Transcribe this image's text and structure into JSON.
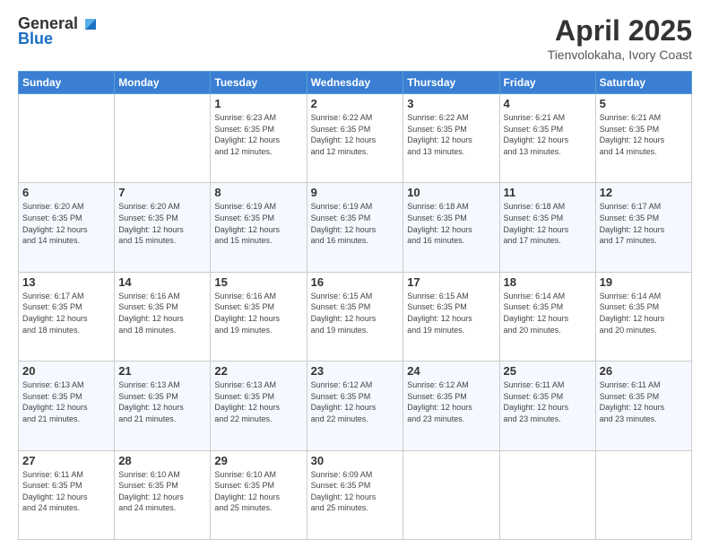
{
  "logo": {
    "line1": "General",
    "line2": "Blue"
  },
  "title": "April 2025",
  "location": "Tienvolokaha, Ivory Coast",
  "days_of_week": [
    "Sunday",
    "Monday",
    "Tuesday",
    "Wednesday",
    "Thursday",
    "Friday",
    "Saturday"
  ],
  "weeks": [
    [
      {
        "day": "",
        "info": ""
      },
      {
        "day": "",
        "info": ""
      },
      {
        "day": "1",
        "info": "Sunrise: 6:23 AM\nSunset: 6:35 PM\nDaylight: 12 hours\nand 12 minutes."
      },
      {
        "day": "2",
        "info": "Sunrise: 6:22 AM\nSunset: 6:35 PM\nDaylight: 12 hours\nand 12 minutes."
      },
      {
        "day": "3",
        "info": "Sunrise: 6:22 AM\nSunset: 6:35 PM\nDaylight: 12 hours\nand 13 minutes."
      },
      {
        "day": "4",
        "info": "Sunrise: 6:21 AM\nSunset: 6:35 PM\nDaylight: 12 hours\nand 13 minutes."
      },
      {
        "day": "5",
        "info": "Sunrise: 6:21 AM\nSunset: 6:35 PM\nDaylight: 12 hours\nand 14 minutes."
      }
    ],
    [
      {
        "day": "6",
        "info": "Sunrise: 6:20 AM\nSunset: 6:35 PM\nDaylight: 12 hours\nand 14 minutes."
      },
      {
        "day": "7",
        "info": "Sunrise: 6:20 AM\nSunset: 6:35 PM\nDaylight: 12 hours\nand 15 minutes."
      },
      {
        "day": "8",
        "info": "Sunrise: 6:19 AM\nSunset: 6:35 PM\nDaylight: 12 hours\nand 15 minutes."
      },
      {
        "day": "9",
        "info": "Sunrise: 6:19 AM\nSunset: 6:35 PM\nDaylight: 12 hours\nand 16 minutes."
      },
      {
        "day": "10",
        "info": "Sunrise: 6:18 AM\nSunset: 6:35 PM\nDaylight: 12 hours\nand 16 minutes."
      },
      {
        "day": "11",
        "info": "Sunrise: 6:18 AM\nSunset: 6:35 PM\nDaylight: 12 hours\nand 17 minutes."
      },
      {
        "day": "12",
        "info": "Sunrise: 6:17 AM\nSunset: 6:35 PM\nDaylight: 12 hours\nand 17 minutes."
      }
    ],
    [
      {
        "day": "13",
        "info": "Sunrise: 6:17 AM\nSunset: 6:35 PM\nDaylight: 12 hours\nand 18 minutes."
      },
      {
        "day": "14",
        "info": "Sunrise: 6:16 AM\nSunset: 6:35 PM\nDaylight: 12 hours\nand 18 minutes."
      },
      {
        "day": "15",
        "info": "Sunrise: 6:16 AM\nSunset: 6:35 PM\nDaylight: 12 hours\nand 19 minutes."
      },
      {
        "day": "16",
        "info": "Sunrise: 6:15 AM\nSunset: 6:35 PM\nDaylight: 12 hours\nand 19 minutes."
      },
      {
        "day": "17",
        "info": "Sunrise: 6:15 AM\nSunset: 6:35 PM\nDaylight: 12 hours\nand 19 minutes."
      },
      {
        "day": "18",
        "info": "Sunrise: 6:14 AM\nSunset: 6:35 PM\nDaylight: 12 hours\nand 20 minutes."
      },
      {
        "day": "19",
        "info": "Sunrise: 6:14 AM\nSunset: 6:35 PM\nDaylight: 12 hours\nand 20 minutes."
      }
    ],
    [
      {
        "day": "20",
        "info": "Sunrise: 6:13 AM\nSunset: 6:35 PM\nDaylight: 12 hours\nand 21 minutes."
      },
      {
        "day": "21",
        "info": "Sunrise: 6:13 AM\nSunset: 6:35 PM\nDaylight: 12 hours\nand 21 minutes."
      },
      {
        "day": "22",
        "info": "Sunrise: 6:13 AM\nSunset: 6:35 PM\nDaylight: 12 hours\nand 22 minutes."
      },
      {
        "day": "23",
        "info": "Sunrise: 6:12 AM\nSunset: 6:35 PM\nDaylight: 12 hours\nand 22 minutes."
      },
      {
        "day": "24",
        "info": "Sunrise: 6:12 AM\nSunset: 6:35 PM\nDaylight: 12 hours\nand 23 minutes."
      },
      {
        "day": "25",
        "info": "Sunrise: 6:11 AM\nSunset: 6:35 PM\nDaylight: 12 hours\nand 23 minutes."
      },
      {
        "day": "26",
        "info": "Sunrise: 6:11 AM\nSunset: 6:35 PM\nDaylight: 12 hours\nand 23 minutes."
      }
    ],
    [
      {
        "day": "27",
        "info": "Sunrise: 6:11 AM\nSunset: 6:35 PM\nDaylight: 12 hours\nand 24 minutes."
      },
      {
        "day": "28",
        "info": "Sunrise: 6:10 AM\nSunset: 6:35 PM\nDaylight: 12 hours\nand 24 minutes."
      },
      {
        "day": "29",
        "info": "Sunrise: 6:10 AM\nSunset: 6:35 PM\nDaylight: 12 hours\nand 25 minutes."
      },
      {
        "day": "30",
        "info": "Sunrise: 6:09 AM\nSunset: 6:35 PM\nDaylight: 12 hours\nand 25 minutes."
      },
      {
        "day": "",
        "info": ""
      },
      {
        "day": "",
        "info": ""
      },
      {
        "day": "",
        "info": ""
      }
    ]
  ]
}
